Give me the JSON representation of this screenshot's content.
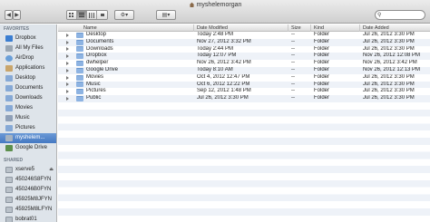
{
  "window": {
    "title": "myshelemorgan"
  },
  "sidebar": {
    "favorites_header": "FAVORITES",
    "favorites": [
      {
        "label": "Dropbox",
        "icon": "dropbox-icon"
      },
      {
        "label": "All My Files",
        "icon": "all-files-icon"
      },
      {
        "label": "AirDrop",
        "icon": "airdrop-icon"
      },
      {
        "label": "Applications",
        "icon": "applications-icon"
      },
      {
        "label": "Desktop",
        "icon": "desktop-icon"
      },
      {
        "label": "Documents",
        "icon": "documents-icon"
      },
      {
        "label": "Downloads",
        "icon": "downloads-icon"
      },
      {
        "label": "Movies",
        "icon": "movies-icon"
      },
      {
        "label": "Music",
        "icon": "music-icon"
      },
      {
        "label": "Pictures",
        "icon": "pictures-icon"
      },
      {
        "label": "myshelem...",
        "icon": "home-icon",
        "selected": true
      },
      {
        "label": "Google Drive",
        "icon": "google-drive-icon"
      }
    ],
    "shared_header": "SHARED",
    "shared": [
      {
        "label": "xserve5",
        "icon": "server-icon",
        "eject": true
      },
      {
        "label": "450246S8FYN",
        "icon": "server-icon"
      },
      {
        "label": "450246B0FYN",
        "icon": "server-icon"
      },
      {
        "label": "45925M8JFYN",
        "icon": "server-icon"
      },
      {
        "label": "45925M8LFYN",
        "icon": "server-icon"
      },
      {
        "label": "bobrat01",
        "icon": "server-icon"
      }
    ]
  },
  "columns": {
    "name": "Name",
    "date_modified": "Date Modified",
    "size": "Size",
    "kind": "Kind",
    "date_added": "Date Added"
  },
  "files": [
    {
      "name": "Desktop",
      "modified": "Today 2:48 PM",
      "size": "--",
      "kind": "Folder",
      "added": "Jul 26, 2012 3:30 PM"
    },
    {
      "name": "Documents",
      "modified": "Nov 27, 2012 3:32 PM",
      "size": "--",
      "kind": "Folder",
      "added": "Jul 26, 2012 3:30 PM"
    },
    {
      "name": "Downloads",
      "modified": "Today 2:44 PM",
      "size": "--",
      "kind": "Folder",
      "added": "Jul 26, 2012 3:30 PM"
    },
    {
      "name": "Dropbox",
      "modified": "Today 12:07 PM",
      "size": "--",
      "kind": "Folder",
      "added": "Nov 26, 2012 12:08 PM"
    },
    {
      "name": "dwhelper",
      "modified": "Nov 26, 2012 3:42 PM",
      "size": "--",
      "kind": "Folder",
      "added": "Nov 26, 2012 3:42 PM"
    },
    {
      "name": "Google Drive",
      "modified": "Today 8:10 AM",
      "size": "--",
      "kind": "Folder",
      "added": "Nov 26, 2012 12:13 PM"
    },
    {
      "name": "Movies",
      "modified": "Oct 4, 2012 12:47 PM",
      "size": "--",
      "kind": "Folder",
      "added": "Jul 26, 2012 3:30 PM"
    },
    {
      "name": "Music",
      "modified": "Oct 6, 2012 12:22 PM",
      "size": "--",
      "kind": "Folder",
      "added": "Jul 26, 2012 3:30 PM"
    },
    {
      "name": "Pictures",
      "modified": "Sep 12, 2012 1:48 PM",
      "size": "--",
      "kind": "Folder",
      "added": "Jul 26, 2012 3:30 PM"
    },
    {
      "name": "Public",
      "modified": "Jul 26, 2012 3:30 PM",
      "size": "--",
      "kind": "Folder",
      "added": "Jul 26, 2012 3:30 PM"
    }
  ]
}
